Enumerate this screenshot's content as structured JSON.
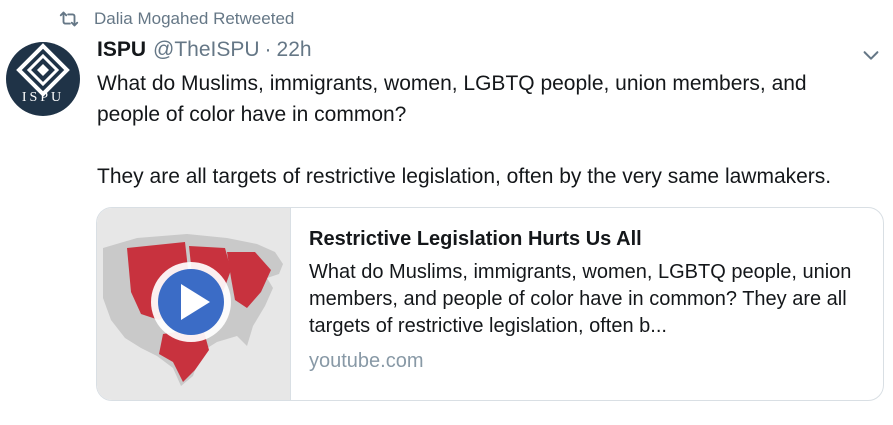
{
  "retweet": {
    "icon": "retweet-icon",
    "text": "Dalia Mogahed Retweeted"
  },
  "avatar": {
    "icon": "diamond-logo-icon",
    "text": "ISPU",
    "bg_color": "#1f3347"
  },
  "tweet": {
    "name": "ISPU",
    "handle": "@TheISPU",
    "separator": "·",
    "time": "22h",
    "menu_icon": "chevron-down-icon",
    "paragraphs": [
      "What do Muslims, immigrants, women, LGBTQ people, union members, and people of color have in common?",
      "They are all targets of restrictive legislation, often by the very same lawmakers."
    ]
  },
  "card": {
    "thumbnail_icon": "play-button-icon",
    "title": "Restrictive Legislation Hurts Us All",
    "description": "What do Muslims, immigrants, women, LGBTQ people, union members, and people of color have in common? They are all targets of restrictive legislation, often b...",
    "domain": "youtube.com",
    "map_color": "#c8323e",
    "play_color": "#3b6cc6"
  },
  "colors": {
    "text_primary": "#14171a",
    "text_secondary": "#657786",
    "border": "#d9dfe4"
  }
}
